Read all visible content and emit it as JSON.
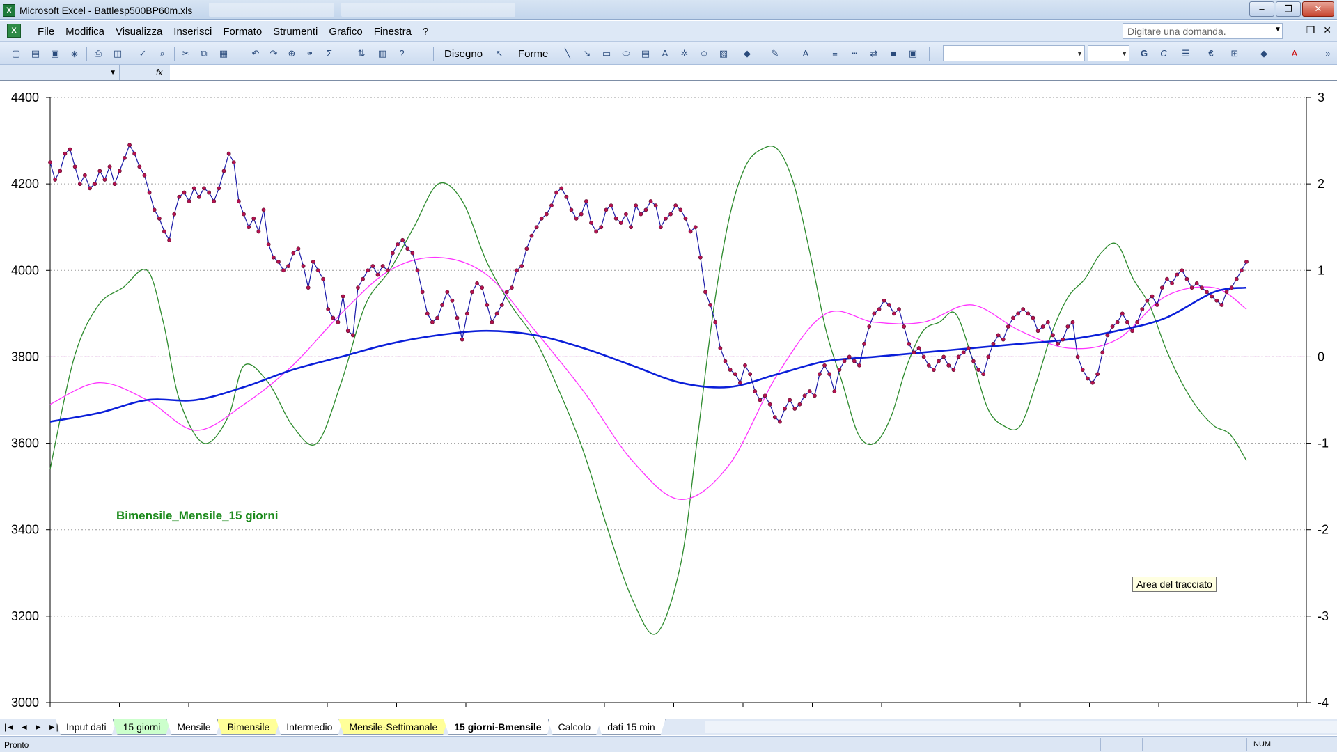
{
  "window": {
    "title": "Microsoft Excel - Battlesp500BP60m.xls",
    "controls": {
      "minimize": "–",
      "maximize": "❐",
      "close": "✕"
    }
  },
  "menubar": {
    "items": [
      "File",
      "Modifica",
      "Visualizza",
      "Inserisci",
      "Formato",
      "Strumenti",
      "Grafico",
      "Finestra",
      "?"
    ],
    "help_placeholder": "Digitare una domanda.",
    "mdi_controls": [
      "–",
      "❐",
      "✕"
    ]
  },
  "toolbar": {
    "disegno_label": "Disegno",
    "forme_label": "Forme",
    "icons": [
      "new-icon",
      "open-icon",
      "save-icon",
      "permission-icon",
      "print-icon",
      "print-preview-icon",
      "spelling-icon",
      "research-icon",
      "cut-icon",
      "copy-icon",
      "paste-icon",
      "undo-icon",
      "redo-icon",
      "insert-hyperlink-icon",
      "sum-icon",
      "sort-icon",
      "chart-wizard-icon",
      "help-icon"
    ],
    "bold_label": "G",
    "italic_label": "C",
    "euro_label": "€"
  },
  "formulabar": {
    "fx_label": "fx"
  },
  "chart": {
    "annotation": "Bimensile_Mensile_15 giorni",
    "tooltip": "Area del tracciato"
  },
  "chart_data": {
    "type": "line",
    "y_left": {
      "min": 3000,
      "max": 4400,
      "ticks": [
        "3000",
        "3200",
        "3400",
        "3600",
        "3800",
        "4000",
        "4200",
        "4400"
      ]
    },
    "y_right": {
      "min": -4,
      "max": 3,
      "ticks": [
        "-4",
        "-3",
        "-2",
        "-1",
        "0",
        "1",
        "2",
        "3"
      ]
    },
    "grid": "horizontal dotted",
    "zero_line_right": 0,
    "colors": {
      "price": "#1a1aa8",
      "price_marker": "#b3124f",
      "blue_ma": "#0b1fd9",
      "magenta": "#ff33ff",
      "green": "#2e8b2e",
      "zero_line": "#cc44cc",
      "annotation": "#1b8a1b"
    },
    "series": [
      {
        "axis": "left",
        "style": "line-markers",
        "values": [
          4250,
          4210,
          4230,
          4270,
          4280,
          4240,
          4200,
          4220,
          4190,
          4200,
          4230,
          4210,
          4240,
          4200,
          4230,
          4260,
          4290,
          4270,
          4240,
          4220,
          4180,
          4140,
          4120,
          4090,
          4070,
          4130,
          4170,
          4180,
          4160,
          4190,
          4170,
          4190,
          4180,
          4160,
          4190,
          4230,
          4270,
          4250,
          4160,
          4130,
          4100,
          4120,
          4090,
          4140,
          4060,
          4030,
          4020,
          4000,
          4010,
          4040,
          4050,
          4010,
          3960,
          4020,
          4000,
          3980,
          3910,
          3890,
          3880,
          3940,
          3860,
          3850,
          3960,
          3980,
          4000,
          4010,
          3990,
          4010,
          4000,
          4040,
          4060,
          4070,
          4050,
          4040,
          4000,
          3950,
          3900,
          3880,
          3890,
          3920,
          3950,
          3930,
          3890,
          3840,
          3900,
          3950,
          3970,
          3960,
          3920,
          3880,
          3900,
          3920,
          3950,
          3960,
          4000,
          4010,
          4050,
          4080,
          4100,
          4120,
          4130,
          4150,
          4180,
          4190,
          4170,
          4140,
          4120,
          4130,
          4160,
          4110,
          4090,
          4100,
          4140,
          4150,
          4120,
          4110,
          4130,
          4100,
          4150,
          4130,
          4140,
          4160,
          4150,
          4100,
          4120,
          4130,
          4150,
          4140,
          4120,
          4090,
          4100,
          4030,
          3950,
          3920,
          3880,
          3820,
          3790,
          3770,
          3760,
          3740,
          3780,
          3760,
          3720,
          3700,
          3710,
          3690,
          3660,
          3650,
          3680,
          3700,
          3680,
          3690,
          3710,
          3720,
          3710,
          3760,
          3780,
          3760,
          3720,
          3770,
          3790,
          3800,
          3790,
          3780,
          3830,
          3870,
          3900,
          3910,
          3930,
          3920,
          3900,
          3910,
          3870,
          3830,
          3810,
          3820,
          3800,
          3780,
          3770,
          3790,
          3800,
          3780,
          3770,
          3800,
          3810,
          3820,
          3790,
          3770,
          3760,
          3800,
          3830,
          3850,
          3840,
          3870,
          3890,
          3900,
          3910,
          3900,
          3890,
          3860,
          3870,
          3880,
          3850,
          3830,
          3840,
          3870,
          3880,
          3800,
          3770,
          3750,
          3740,
          3760,
          3810,
          3850,
          3870,
          3880,
          3900,
          3880,
          3860,
          3880,
          3910,
          3930,
          3940,
          3920,
          3960,
          3980,
          3970,
          3990,
          4000,
          3980,
          3960,
          3970,
          3960,
          3950,
          3940,
          3930,
          3920,
          3950,
          3960,
          3980,
          4000,
          4020
        ]
      },
      {
        "axis": "left",
        "style": "thick-line",
        "x": [
          0,
          30,
          60,
          90,
          120,
          150,
          180,
          210,
          240,
          270,
          300,
          330,
          360,
          390,
          420,
          450,
          480,
          510,
          540,
          570,
          600,
          630,
          660,
          690,
          720,
          750
        ],
        "values": [
          3650,
          3670,
          3700,
          3700,
          3730,
          3770,
          3800,
          3830,
          3850,
          3860,
          3850,
          3820,
          3780,
          3740,
          3730,
          3760,
          3790,
          3800,
          3810,
          3820,
          3830,
          3840,
          3860,
          3890,
          3950,
          3960
        ],
        "x_end": 740
      },
      {
        "axis": "left",
        "style": "thin-line",
        "x": [
          0,
          30,
          60,
          90,
          120,
          150,
          180,
          210,
          240,
          270,
          300,
          330,
          360,
          390,
          420,
          450,
          480,
          510,
          540,
          570,
          600,
          630,
          660,
          690,
          720,
          750
        ],
        "values": [
          3690,
          3740,
          3700,
          3630,
          3690,
          3780,
          3900,
          4000,
          4030,
          3990,
          3860,
          3720,
          3560,
          3470,
          3550,
          3760,
          3900,
          3880,
          3880,
          3920,
          3860,
          3820,
          3840,
          3940,
          3960,
          3910
        ],
        "x_end": 740
      },
      {
        "axis": "right",
        "style": "thin-line",
        "x": [
          0,
          25,
          50,
          75,
          100,
          125,
          150,
          175,
          200,
          225,
          250,
          275,
          300,
          325,
          350,
          375,
          400,
          425,
          450,
          475,
          500,
          525,
          550,
          575,
          600,
          625,
          650,
          675,
          700,
          725,
          750
        ],
        "values": [
          -0.6,
          0.3,
          0.7,
          1.0,
          -0.4,
          -0.9,
          -0.6,
          0.0,
          0.5,
          -1.0,
          0.0,
          1.2,
          2.0,
          1.6,
          1.2,
          0.4,
          -1.5,
          -2.9,
          -2.7,
          0.6,
          2.2,
          2.1,
          0.4,
          -0.8,
          -0.9,
          0.0,
          0.8,
          -0.7,
          0.8,
          1.0,
          -0.3
        ],
        "x_end": 740,
        "override": {
          "x": [
            0,
            15,
            30,
            45,
            60,
            70,
            80,
            95,
            110,
            120,
            135,
            150,
            165,
            180,
            195,
            210,
            225,
            240,
            255,
            270,
            285,
            300,
            315,
            330,
            345,
            360,
            375,
            390,
            400,
            410,
            420,
            430,
            440,
            450,
            460,
            470,
            480,
            490,
            500,
            510,
            520,
            530,
            540,
            550,
            560,
            570,
            580,
            590,
            600,
            610,
            620,
            630,
            640,
            650,
            660,
            670,
            680,
            690,
            700,
            710,
            720,
            730,
            740
          ],
          "values": [
            -1.3,
            0.0,
            0.6,
            0.8,
            1.0,
            0.4,
            -0.5,
            -1.0,
            -0.7,
            -0.1,
            -0.3,
            -0.8,
            -1.0,
            -0.3,
            0.6,
            1.0,
            1.5,
            2.0,
            1.8,
            1.1,
            0.6,
            0.2,
            -0.4,
            -1.1,
            -2.0,
            -2.8,
            -3.2,
            -2.4,
            -1.0,
            0.5,
            1.6,
            2.2,
            2.4,
            2.4,
            2.0,
            1.2,
            0.3,
            -0.3,
            -0.9,
            -1.0,
            -0.7,
            -0.1,
            0.3,
            0.4,
            0.5,
            0.0,
            -0.6,
            -0.8,
            -0.8,
            -0.3,
            0.3,
            0.7,
            0.9,
            1.2,
            1.3,
            0.9,
            0.6,
            0.1,
            -0.3,
            -0.6,
            -0.8,
            -0.9,
            -1.2
          ]
        }
      }
    ]
  },
  "sheet_tabs": {
    "nav": [
      "|◄",
      "◄",
      "►",
      "►|"
    ],
    "tabs": [
      {
        "label": "Input dati",
        "color": ""
      },
      {
        "label": "15 giorni",
        "color": "green"
      },
      {
        "label": "Mensile",
        "color": ""
      },
      {
        "label": "Bimensile",
        "color": "yellow"
      },
      {
        "label": "Intermedio",
        "color": ""
      },
      {
        "label": "Mensile-Settimanale",
        "color": "yellow"
      },
      {
        "label": "15 giorni-Bmensile",
        "color": "active"
      },
      {
        "label": "Calcolo",
        "color": ""
      },
      {
        "label": "dati 15 min",
        "color": ""
      }
    ]
  },
  "statusbar": {
    "status": "Pronto",
    "num": "NUM"
  }
}
